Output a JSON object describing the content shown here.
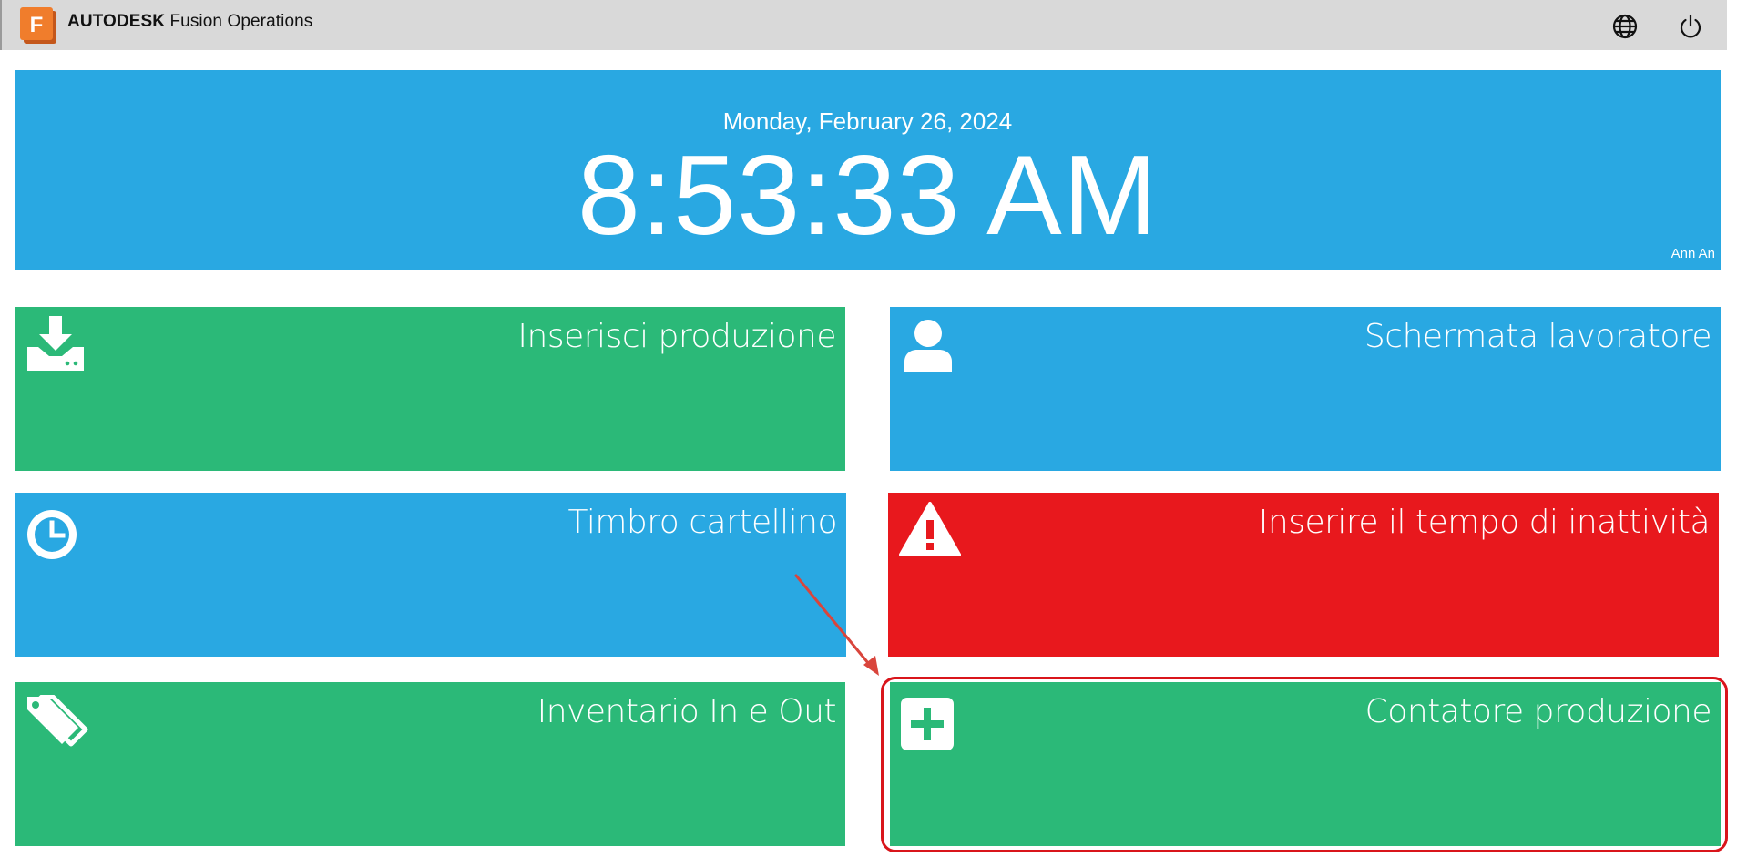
{
  "header": {
    "brand_bold": "AUTODESK",
    "brand_rest": " Fusion Operations",
    "logo_letter": "F",
    "globe_icon": "globe-icon",
    "power_icon": "power-icon"
  },
  "clock": {
    "date": "Monday, February 26, 2024",
    "time": "8:53:33 AM",
    "user": "Ann An"
  },
  "tiles": [
    {
      "label": "Inserisci produzione",
      "icon": "download-tray-icon",
      "color": "#2bb978"
    },
    {
      "label": "Schermata lavoratore",
      "icon": "user-icon",
      "color": "#29a8e2"
    },
    {
      "label": "Timbro cartellino",
      "icon": "clock-icon",
      "color": "#29a8e2"
    },
    {
      "label": "Inserire il tempo di inattività",
      "icon": "warning-icon",
      "color": "#e8181d"
    },
    {
      "label": "Inventario In e Out",
      "icon": "tags-icon",
      "color": "#2bb978"
    },
    {
      "label": "Contatore produzione",
      "icon": "plus-square-icon",
      "color": "#2bb978"
    }
  ],
  "annotation": {
    "highlight_color": "#d9151b",
    "arrow_color": "#d9453c"
  }
}
